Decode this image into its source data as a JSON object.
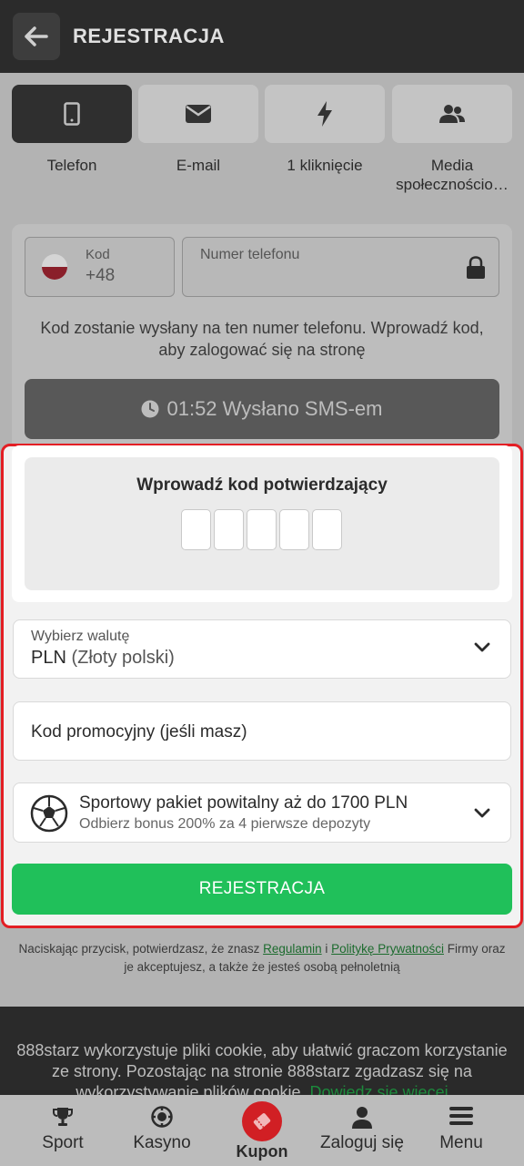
{
  "header": {
    "title": "REJESTRACJA"
  },
  "tabs": [
    {
      "label": "Telefon",
      "icon": "phone-icon",
      "active": true
    },
    {
      "label": "E-mail",
      "icon": "envelope-icon",
      "active": false
    },
    {
      "label": "1 kliknięcie",
      "icon": "lightning-icon",
      "active": false
    },
    {
      "label": "Media społecznościo…",
      "icon": "users-icon",
      "active": false
    }
  ],
  "phone": {
    "code_label": "Kod",
    "code_value": "+48",
    "number_label": "Numer telefonu",
    "info": "Kod zostanie wysłany na ten numer telefonu. Wprowadź kod, aby zalogować się na stronę",
    "sms_button": "01:52 Wysłano SMS-em"
  },
  "verify": {
    "title": "Wprowadź kod potwierdzający",
    "digits": [
      "",
      "",
      "",
      "",
      ""
    ]
  },
  "currency": {
    "label": "Wybierz walutę",
    "value": "PLN",
    "value_sub": "(Złoty polski)"
  },
  "promo": {
    "label": "Kod promocyjny (jeśli masz)"
  },
  "bonus": {
    "title": "Sportowy pakiet powitalny aż do 1700 PLN",
    "subtitle": "Odbierz bonus 200% za 4 pierwsze depozyty"
  },
  "register_button": "REJESTRACJA",
  "terms": {
    "pre": "Naciskając przycisk, potwierdzasz, że znasz ",
    "link1": "Regulamin",
    "mid": " i ",
    "link2": "Politykę Prywatności",
    "post": " Firmy oraz je akceptujesz, a także że jesteś osobą pełnoletnią"
  },
  "cookie": {
    "text": "888starz wykorzystuje pliki cookie, aby ułatwić graczom korzystanie ze strony. Pozostając na stronie 888starz zgadzasz się na wykorzystywanie plików cookie. ",
    "link": "Dowiedz się więcej"
  },
  "bottom_nav": [
    {
      "label": "Sport",
      "icon": "trophy-icon"
    },
    {
      "label": "Kasyno",
      "icon": "casino-chip-icon"
    },
    {
      "label": "Kupon",
      "icon": "ticket-icon"
    },
    {
      "label": "Zaloguj się",
      "icon": "user-icon"
    },
    {
      "label": "Menu",
      "icon": "hamburger-icon"
    }
  ],
  "colors": {
    "accent_green": "#20c05a",
    "highlight_red": "#e31e24",
    "kupon_red": "#d11f24"
  }
}
